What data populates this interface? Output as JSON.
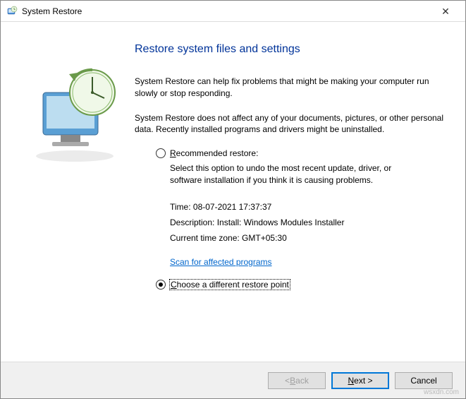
{
  "titlebar": {
    "title": "System Restore"
  },
  "heading": "Restore system files and settings",
  "para1": "System Restore can help fix problems that might be making your computer run slowly or stop responding.",
  "para2": "System Restore does not affect any of your documents, pictures, or other personal data. Recently installed programs and drivers might be uninstalled.",
  "option1": {
    "label_pre": "R",
    "label_post": "ecommended restore:",
    "detail": "Select this option to undo the most recent update, driver, or software installation if you think it is causing problems.",
    "time_label": "Time: ",
    "time_value": "08-07-2021 17:37:37",
    "desc_label": "Description: ",
    "desc_value": "Install: Windows Modules Installer",
    "tz_label": "Current time zone: ",
    "tz_value": "GMT+05:30",
    "scan_link": "Scan for affected programs"
  },
  "option2": {
    "label_pre": "C",
    "label_post": "hoose a different restore point"
  },
  "buttons": {
    "back_pre": "< ",
    "back_u": "B",
    "back_post": "ack",
    "next_u": "N",
    "next_post": "ext >",
    "cancel": "Cancel"
  },
  "watermark": "wsxdn.com"
}
